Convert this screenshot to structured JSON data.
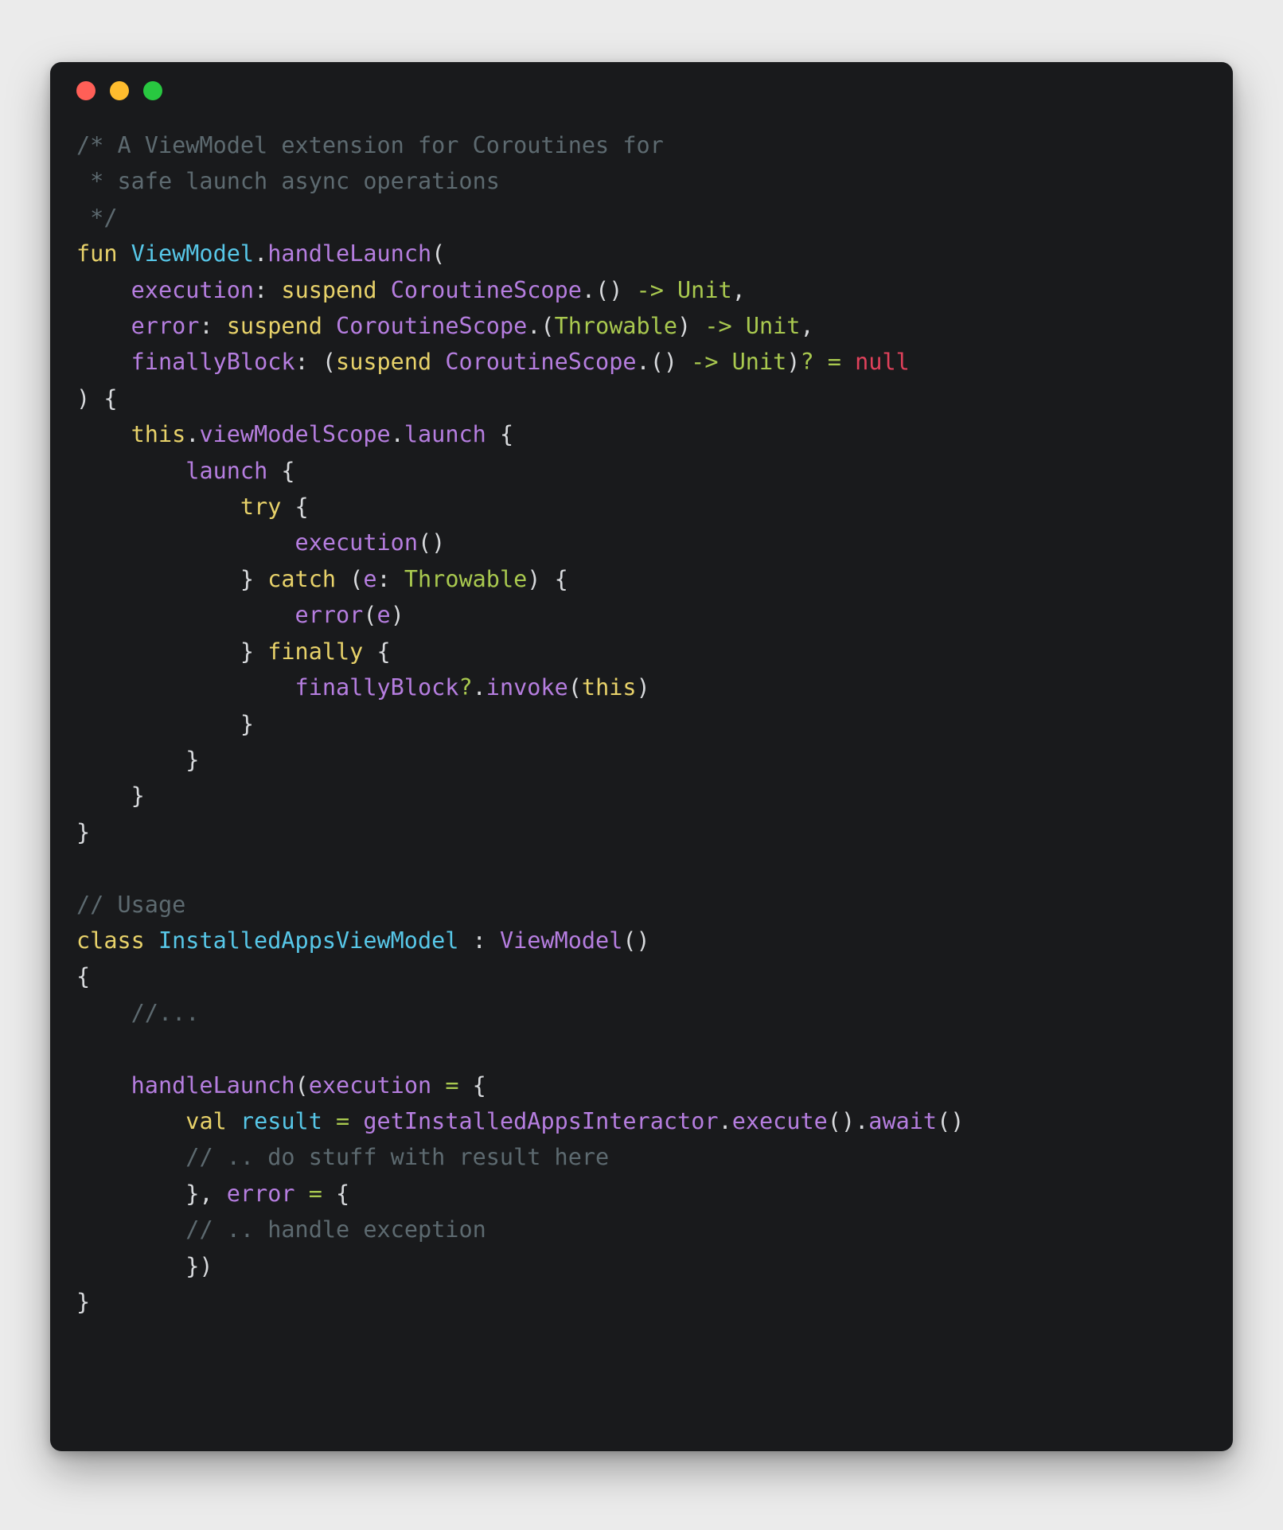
{
  "window": {
    "controls": [
      {
        "name": "close-button",
        "label": "",
        "color": "#ff5f57"
      },
      {
        "name": "minimize-button",
        "label": "",
        "color": "#febc2e"
      },
      {
        "name": "maximize-button",
        "label": "",
        "color": "#28c840"
      }
    ],
    "background": "#191a1c",
    "page_background": "#ebebeb"
  },
  "theme": {
    "comment": "#5d6a70",
    "keyword": "#e8d26a",
    "type": "#57c7e8",
    "function": "#b67ee0",
    "identifier": "#b67ee0",
    "plain": "#d8dadd",
    "green": "#a9c94f",
    "red": "#e0415b"
  },
  "code": {
    "language": "kotlin",
    "lines": [
      {
        "id": 1,
        "text": "/* A ViewModel extension for Coroutines for",
        "tokens": [
          {
            "t": "/* A ViewModel extension for Coroutines for",
            "c": "c-comment"
          }
        ]
      },
      {
        "id": 2,
        "text": " * safe launch async operations",
        "tokens": [
          {
            "t": " * safe launch async operations",
            "c": "c-comment"
          }
        ]
      },
      {
        "id": 3,
        "text": " */",
        "tokens": [
          {
            "t": " */",
            "c": "c-comment"
          }
        ]
      },
      {
        "id": 4,
        "text": "fun ViewModel.handleLaunch(",
        "tokens": [
          {
            "t": "fun ",
            "c": "c-kw"
          },
          {
            "t": "ViewModel",
            "c": "c-type"
          },
          {
            "t": ".",
            "c": "c-plain"
          },
          {
            "t": "handleLaunch",
            "c": "c-fn"
          },
          {
            "t": "(",
            "c": "c-plain"
          }
        ]
      },
      {
        "id": 5,
        "text": "    execution: suspend CoroutineScope.() -> Unit,",
        "tokens": [
          {
            "t": "    ",
            "c": "c-plain"
          },
          {
            "t": "execution",
            "c": "c-ident"
          },
          {
            "t": ": ",
            "c": "c-plain"
          },
          {
            "t": "suspend ",
            "c": "c-kw"
          },
          {
            "t": "CoroutineScope",
            "c": "c-ident"
          },
          {
            "t": ".() ",
            "c": "c-plain"
          },
          {
            "t": "-> Unit",
            "c": "c-green"
          },
          {
            "t": ",",
            "c": "c-plain"
          }
        ]
      },
      {
        "id": 6,
        "text": "    error: suspend CoroutineScope.(Throwable) -> Unit,",
        "tokens": [
          {
            "t": "    ",
            "c": "c-plain"
          },
          {
            "t": "error",
            "c": "c-ident"
          },
          {
            "t": ": ",
            "c": "c-plain"
          },
          {
            "t": "suspend ",
            "c": "c-kw"
          },
          {
            "t": "CoroutineScope",
            "c": "c-ident"
          },
          {
            "t": ".(",
            "c": "c-plain"
          },
          {
            "t": "Throwable",
            "c": "c-green"
          },
          {
            "t": ") ",
            "c": "c-plain"
          },
          {
            "t": "-> Unit",
            "c": "c-green"
          },
          {
            "t": ",",
            "c": "c-plain"
          }
        ]
      },
      {
        "id": 7,
        "text": "    finallyBlock: (suspend CoroutineScope.() -> Unit)? = null",
        "tokens": [
          {
            "t": "    ",
            "c": "c-plain"
          },
          {
            "t": "finallyBlock",
            "c": "c-ident"
          },
          {
            "t": ": (",
            "c": "c-plain"
          },
          {
            "t": "suspend ",
            "c": "c-kw"
          },
          {
            "t": "CoroutineScope",
            "c": "c-ident"
          },
          {
            "t": ".() ",
            "c": "c-plain"
          },
          {
            "t": "-> Unit",
            "c": "c-green"
          },
          {
            "t": ")",
            "c": "c-plain"
          },
          {
            "t": "?",
            "c": "c-green"
          },
          {
            "t": " ",
            "c": "c-plain"
          },
          {
            "t": "=",
            "c": "c-green"
          },
          {
            "t": " ",
            "c": "c-plain"
          },
          {
            "t": "null",
            "c": "c-red"
          }
        ]
      },
      {
        "id": 8,
        "text": ") {",
        "tokens": [
          {
            "t": ") {",
            "c": "c-plain"
          }
        ]
      },
      {
        "id": 9,
        "text": "    this.viewModelScope.launch {",
        "tokens": [
          {
            "t": "    ",
            "c": "c-plain"
          },
          {
            "t": "this",
            "c": "c-kw"
          },
          {
            "t": ".",
            "c": "c-plain"
          },
          {
            "t": "viewModelScope",
            "c": "c-ident"
          },
          {
            "t": ".",
            "c": "c-plain"
          },
          {
            "t": "launch",
            "c": "c-fn"
          },
          {
            "t": " {",
            "c": "c-plain"
          }
        ]
      },
      {
        "id": 10,
        "text": "        launch {",
        "tokens": [
          {
            "t": "        ",
            "c": "c-plain"
          },
          {
            "t": "launch",
            "c": "c-fn"
          },
          {
            "t": " {",
            "c": "c-plain"
          }
        ]
      },
      {
        "id": 11,
        "text": "            try {",
        "tokens": [
          {
            "t": "            ",
            "c": "c-plain"
          },
          {
            "t": "try",
            "c": "c-kw"
          },
          {
            "t": " {",
            "c": "c-plain"
          }
        ]
      },
      {
        "id": 12,
        "text": "                execution()",
        "tokens": [
          {
            "t": "                ",
            "c": "c-plain"
          },
          {
            "t": "execution",
            "c": "c-fn"
          },
          {
            "t": "()",
            "c": "c-plain"
          }
        ]
      },
      {
        "id": 13,
        "text": "            } catch (e: Throwable) {",
        "tokens": [
          {
            "t": "            } ",
            "c": "c-plain"
          },
          {
            "t": "catch",
            "c": "c-kw"
          },
          {
            "t": " (",
            "c": "c-plain"
          },
          {
            "t": "e",
            "c": "c-ident"
          },
          {
            "t": ": ",
            "c": "c-plain"
          },
          {
            "t": "Throwable",
            "c": "c-green"
          },
          {
            "t": ") {",
            "c": "c-plain"
          }
        ]
      },
      {
        "id": 14,
        "text": "                error(e)",
        "tokens": [
          {
            "t": "                ",
            "c": "c-plain"
          },
          {
            "t": "error",
            "c": "c-fn"
          },
          {
            "t": "(",
            "c": "c-plain"
          },
          {
            "t": "e",
            "c": "c-ident"
          },
          {
            "t": ")",
            "c": "c-plain"
          }
        ]
      },
      {
        "id": 15,
        "text": "            } finally {",
        "tokens": [
          {
            "t": "            } ",
            "c": "c-plain"
          },
          {
            "t": "finally",
            "c": "c-kw"
          },
          {
            "t": " {",
            "c": "c-plain"
          }
        ]
      },
      {
        "id": 16,
        "text": "                finallyBlock?.invoke(this)",
        "tokens": [
          {
            "t": "                ",
            "c": "c-plain"
          },
          {
            "t": "finallyBlock",
            "c": "c-ident"
          },
          {
            "t": "?",
            "c": "c-green"
          },
          {
            "t": ".",
            "c": "c-plain"
          },
          {
            "t": "invoke",
            "c": "c-fn"
          },
          {
            "t": "(",
            "c": "c-plain"
          },
          {
            "t": "this",
            "c": "c-kw"
          },
          {
            "t": ")",
            "c": "c-plain"
          }
        ]
      },
      {
        "id": 17,
        "text": "            }",
        "tokens": [
          {
            "t": "            }",
            "c": "c-plain"
          }
        ]
      },
      {
        "id": 18,
        "text": "        }",
        "tokens": [
          {
            "t": "        }",
            "c": "c-plain"
          }
        ]
      },
      {
        "id": 19,
        "text": "    }",
        "tokens": [
          {
            "t": "    }",
            "c": "c-plain"
          }
        ]
      },
      {
        "id": 20,
        "text": "}",
        "tokens": [
          {
            "t": "}",
            "c": "c-plain"
          }
        ]
      },
      {
        "id": 21,
        "text": "",
        "tokens": [
          {
            "t": " ",
            "c": "c-plain"
          }
        ]
      },
      {
        "id": 22,
        "text": "// Usage",
        "tokens": [
          {
            "t": "// Usage",
            "c": "c-comment"
          }
        ]
      },
      {
        "id": 23,
        "text": "class InstalledAppsViewModel : ViewModel()",
        "tokens": [
          {
            "t": "class ",
            "c": "c-kw"
          },
          {
            "t": "InstalledAppsViewModel",
            "c": "c-type"
          },
          {
            "t": " : ",
            "c": "c-plain"
          },
          {
            "t": "ViewModel",
            "c": "c-fn"
          },
          {
            "t": "()",
            "c": "c-plain"
          }
        ]
      },
      {
        "id": 24,
        "text": "{",
        "tokens": [
          {
            "t": "{",
            "c": "c-plain"
          }
        ]
      },
      {
        "id": 25,
        "text": "    //...",
        "tokens": [
          {
            "t": "    ",
            "c": "c-plain"
          },
          {
            "t": "//...",
            "c": "c-comment"
          }
        ]
      },
      {
        "id": 26,
        "text": "",
        "tokens": [
          {
            "t": " ",
            "c": "c-plain"
          }
        ]
      },
      {
        "id": 27,
        "text": "    handleLaunch(execution = {",
        "tokens": [
          {
            "t": "    ",
            "c": "c-plain"
          },
          {
            "t": "handleLaunch",
            "c": "c-fn"
          },
          {
            "t": "(",
            "c": "c-plain"
          },
          {
            "t": "execution",
            "c": "c-ident"
          },
          {
            "t": " ",
            "c": "c-plain"
          },
          {
            "t": "=",
            "c": "c-green"
          },
          {
            "t": " {",
            "c": "c-plain"
          }
        ]
      },
      {
        "id": 28,
        "text": "        val result = getInstalledAppsInteractor.execute().await()",
        "tokens": [
          {
            "t": "        ",
            "c": "c-plain"
          },
          {
            "t": "val ",
            "c": "c-kw"
          },
          {
            "t": "result",
            "c": "c-type"
          },
          {
            "t": " ",
            "c": "c-plain"
          },
          {
            "t": "=",
            "c": "c-green"
          },
          {
            "t": " ",
            "c": "c-plain"
          },
          {
            "t": "getInstalledAppsInteractor",
            "c": "c-ident"
          },
          {
            "t": ".",
            "c": "c-plain"
          },
          {
            "t": "execute",
            "c": "c-fn"
          },
          {
            "t": "().",
            "c": "c-plain"
          },
          {
            "t": "await",
            "c": "c-fn"
          },
          {
            "t": "()",
            "c": "c-plain"
          }
        ]
      },
      {
        "id": 29,
        "text": "        // .. do stuff with result here",
        "tokens": [
          {
            "t": "        ",
            "c": "c-plain"
          },
          {
            "t": "// .. do stuff with result here",
            "c": "c-comment"
          }
        ]
      },
      {
        "id": 30,
        "text": "        }, error = {",
        "tokens": [
          {
            "t": "        }, ",
            "c": "c-plain"
          },
          {
            "t": "error",
            "c": "c-ident"
          },
          {
            "t": " ",
            "c": "c-plain"
          },
          {
            "t": "=",
            "c": "c-green"
          },
          {
            "t": " {",
            "c": "c-plain"
          }
        ]
      },
      {
        "id": 31,
        "text": "        // .. handle exception",
        "tokens": [
          {
            "t": "        ",
            "c": "c-plain"
          },
          {
            "t": "// .. handle exception",
            "c": "c-comment"
          }
        ]
      },
      {
        "id": 32,
        "text": "        })",
        "tokens": [
          {
            "t": "        })",
            "c": "c-plain"
          }
        ]
      },
      {
        "id": 33,
        "text": "}",
        "tokens": [
          {
            "t": "}",
            "c": "c-plain"
          }
        ]
      }
    ]
  }
}
